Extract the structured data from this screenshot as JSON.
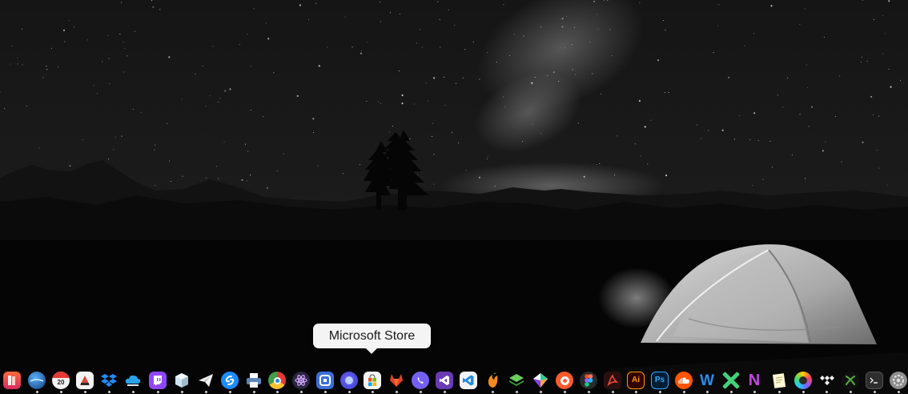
{
  "tooltip": {
    "text": "Microsoft Store"
  },
  "dock": {
    "items": [
      {
        "name": "books-app-icon",
        "label": ""
      },
      {
        "name": "earth-globe-icon",
        "label": ""
      },
      {
        "name": "calendar-icon",
        "label": "20"
      },
      {
        "name": "image-editor-icon",
        "label": ""
      },
      {
        "name": "dropbox-icon",
        "label": ""
      },
      {
        "name": "cloud-sync-icon",
        "label": ""
      },
      {
        "name": "twitch-icon",
        "label": ""
      },
      {
        "name": "cube-icon",
        "label": ""
      },
      {
        "name": "telegram-icon",
        "label": ""
      },
      {
        "name": "shazam-icon",
        "label": ""
      },
      {
        "name": "printer-icon",
        "label": ""
      },
      {
        "name": "chrome-icon",
        "label": ""
      },
      {
        "name": "atom-icon",
        "label": ""
      },
      {
        "name": "dev-tool-icon",
        "label": ""
      },
      {
        "name": "firefox-icon",
        "label": ""
      },
      {
        "name": "microsoft-store-icon",
        "label": ""
      },
      {
        "name": "gitlab-fox-icon",
        "label": ""
      },
      {
        "name": "viber-icon",
        "label": ""
      },
      {
        "name": "visual-studio-icon",
        "label": ""
      },
      {
        "name": "vscode-icon",
        "label": ""
      },
      {
        "name": "fl-studio-icon",
        "label": ""
      },
      {
        "name": "layers-stack-icon",
        "label": ""
      },
      {
        "name": "sketch-gem-icon",
        "label": ""
      },
      {
        "name": "orange-ring-icon",
        "label": ""
      },
      {
        "name": "figma-icon",
        "label": ""
      },
      {
        "name": "acrobat-icon",
        "label": ""
      },
      {
        "name": "illustrator-icon",
        "label": "Ai"
      },
      {
        "name": "photoshop-icon",
        "label": "Ps"
      },
      {
        "name": "soundcloud-icon",
        "label": ""
      },
      {
        "name": "word-app-icon",
        "label": "W"
      },
      {
        "name": "xmind-icon",
        "label": ""
      },
      {
        "name": "notion-n-icon",
        "label": "N"
      },
      {
        "name": "notes-icon",
        "label": ""
      },
      {
        "name": "colorful-orb-icon",
        "label": ""
      },
      {
        "name": "tidal-icon",
        "label": ""
      },
      {
        "name": "xbox-icon",
        "label": ""
      },
      {
        "name": "terminal-icon",
        "label": ""
      },
      {
        "name": "settings-icon",
        "label": ""
      }
    ],
    "running": [
      1,
      2,
      3,
      4,
      5,
      6,
      7,
      8,
      9,
      10,
      11,
      12,
      13,
      14,
      15,
      16,
      17,
      18,
      20,
      21,
      22,
      23,
      24,
      25,
      26,
      27,
      28,
      29,
      30,
      31,
      32,
      33,
      34,
      35,
      36,
      37
    ]
  }
}
